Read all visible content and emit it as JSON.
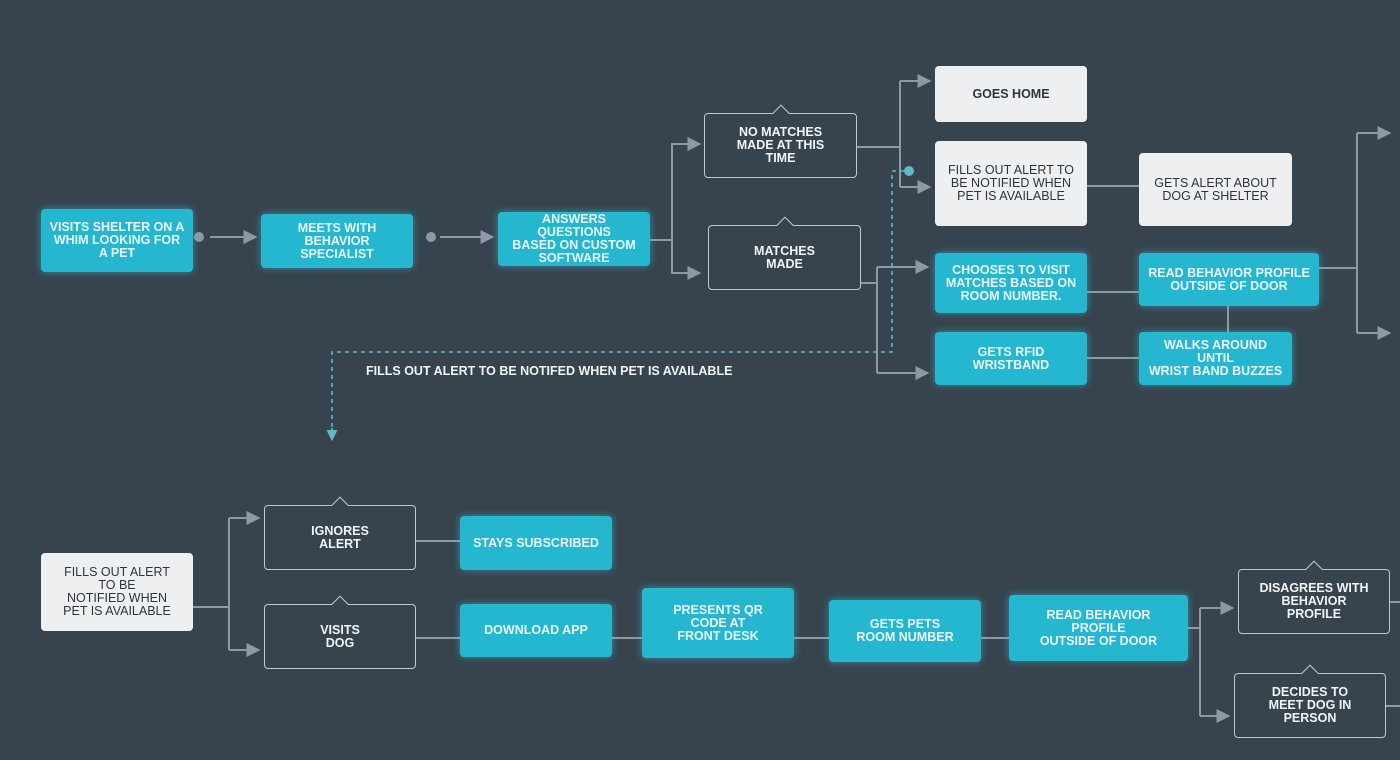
{
  "colors": {
    "background": "#37444e",
    "accent": "#25b6d0",
    "connector": "#8e9aa2",
    "neutral": "#eeeff0"
  },
  "top_flow": {
    "visits_shelter": "Visits shelter on a\nwhim looking for\na pet",
    "meets_specialist": "Meets with\nbehavior\nspecialist",
    "answers_questions": "Answers questions\nbased on custom\nsoftware",
    "no_matches": "No matches\nmade at this\ntime",
    "matches_made": "Matches\nmade",
    "goes_home": "Goes home",
    "fills_alert": "Fills out alert to\nbe notified when\npet is available",
    "gets_alert": "Gets alert about\ndog at shelter",
    "chooses_visit": "Chooses to visit\nmatches based on\nroom number.",
    "read_profile": "Read behavior profile\noutside of door",
    "gets_rfid": "Gets RFID\nwristband",
    "walks_around": "Walks around until\nwrist band buzzes",
    "dashed_label": "Fills out alert to be notifed when pet is available"
  },
  "bottom_flow": {
    "fills_alert": "Fills out alert\nto be\nnotified when\npet is available",
    "ignores_alert": "Ignores\nalert",
    "visits_dog": "Visits\ndog",
    "stays_subscribed": "Stays subscribed",
    "download_app": "Download app",
    "presents_qr": "Presents QR\ncode at\nfront desk",
    "gets_room": "Gets pets\nroom number",
    "read_profile": "Read behavior\nprofile\noutside of door",
    "disagrees": "Disagrees with\nbehavior\nprofile",
    "decides_meet": "Decides to\nmeet dog in\nperson"
  }
}
